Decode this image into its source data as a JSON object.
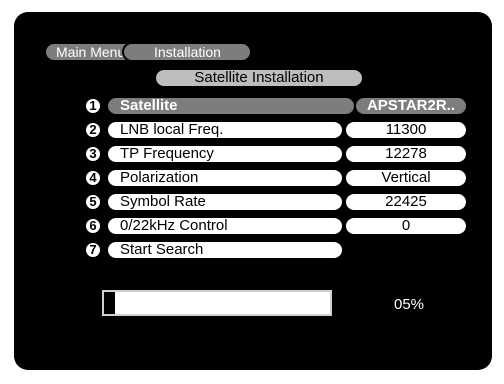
{
  "breadcrumb": {
    "main_menu": "Main Menu",
    "installation": "Installation"
  },
  "page_title": "Satellite Installation",
  "rows": [
    {
      "num": "1",
      "label": "Satellite",
      "value": "APSTAR2R.."
    },
    {
      "num": "2",
      "label": "LNB local Freq.",
      "value": "11300"
    },
    {
      "num": "3",
      "label": "TP Frequency",
      "value": "12278"
    },
    {
      "num": "4",
      "label": "Polarization",
      "value": "Vertical"
    },
    {
      "num": "5",
      "label": "Symbol Rate",
      "value": "22425"
    },
    {
      "num": "6",
      "label": "0/22kHz Control",
      "value": "0"
    },
    {
      "num": "7",
      "label": "Start Search"
    }
  ],
  "progress": {
    "fraction": 0.05,
    "text": "05%"
  }
}
